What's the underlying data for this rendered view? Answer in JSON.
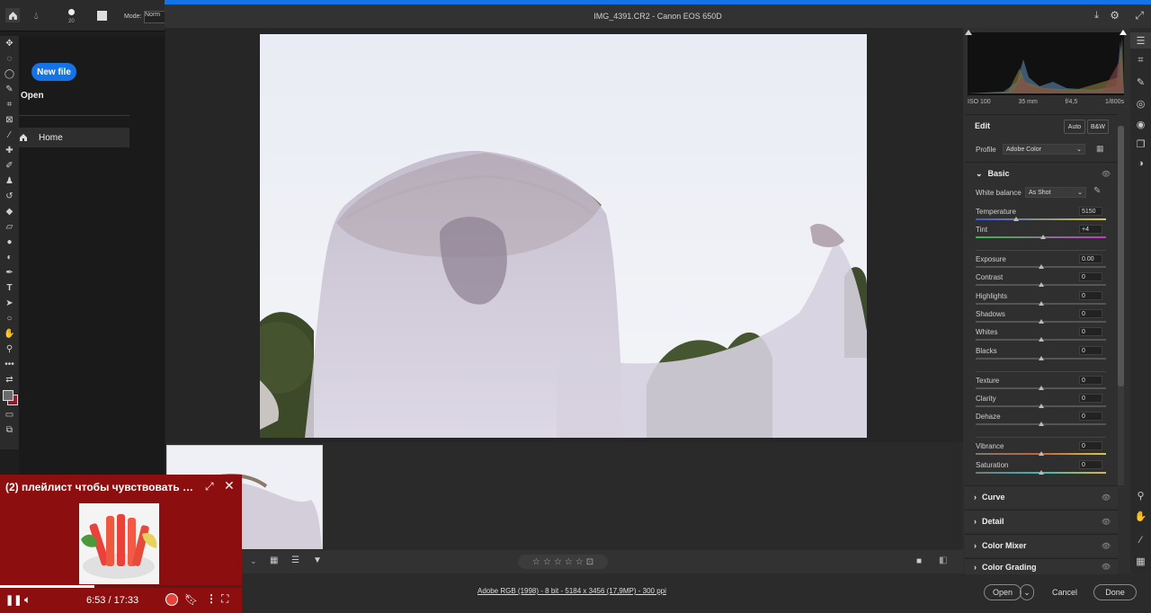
{
  "photoshop": {
    "mode_label": "Mode:",
    "mode_value": "Norm",
    "brush_size": "20",
    "new_file_label": "New file",
    "open_label": "Open",
    "home_label": "Home"
  },
  "acr": {
    "title": "IMG_4391.CR2  -  Canon EOS 650D",
    "camera_info": {
      "iso": "ISO 100",
      "focal": "35 mm",
      "aperture": "f/4,5",
      "shutter": "1/800s"
    },
    "edit": {
      "title": "Edit",
      "auto_label": "Auto",
      "bw_label": "B&W"
    },
    "profile": {
      "label": "Profile",
      "value": "Adobe Color"
    },
    "basic": {
      "title": "Basic",
      "white_balance_label": "White balance",
      "white_balance_value": "As Shot",
      "sliders": [
        {
          "label": "Temperature",
          "value": "5150",
          "pos": 0.31
        },
        {
          "label": "Tint",
          "value": "+4",
          "pos": 0.52
        },
        {
          "label": "Exposure",
          "value": "0.00",
          "pos": 0.5
        },
        {
          "label": "Contrast",
          "value": "0",
          "pos": 0.5
        },
        {
          "label": "Highlights",
          "value": "0",
          "pos": 0.5
        },
        {
          "label": "Shadows",
          "value": "0",
          "pos": 0.5
        },
        {
          "label": "Whites",
          "value": "0",
          "pos": 0.5
        },
        {
          "label": "Blacks",
          "value": "0",
          "pos": 0.5
        },
        {
          "label": "Texture",
          "value": "0",
          "pos": 0.5
        },
        {
          "label": "Clarity",
          "value": "0",
          "pos": 0.5
        },
        {
          "label": "Dehaze",
          "value": "0",
          "pos": 0.5
        },
        {
          "label": "Vibrance",
          "value": "0",
          "pos": 0.5
        },
        {
          "label": "Saturation",
          "value": "0",
          "pos": 0.5
        }
      ]
    },
    "sections": [
      "Curve",
      "Detail",
      "Color Mixer",
      "Color Grading"
    ],
    "color_info": "Adobe RGB (1998) - 8 bit - 5184 x 3456 (17,9MP) - 300 ppi",
    "buttons": {
      "open": "Open",
      "cancel": "Cancel",
      "done": "Done"
    },
    "rating_stars": 5
  },
  "video": {
    "title": "(2) плейлист чтобы чувствовать с...",
    "time": "6:53 / 17:33",
    "progress": 0.392
  }
}
